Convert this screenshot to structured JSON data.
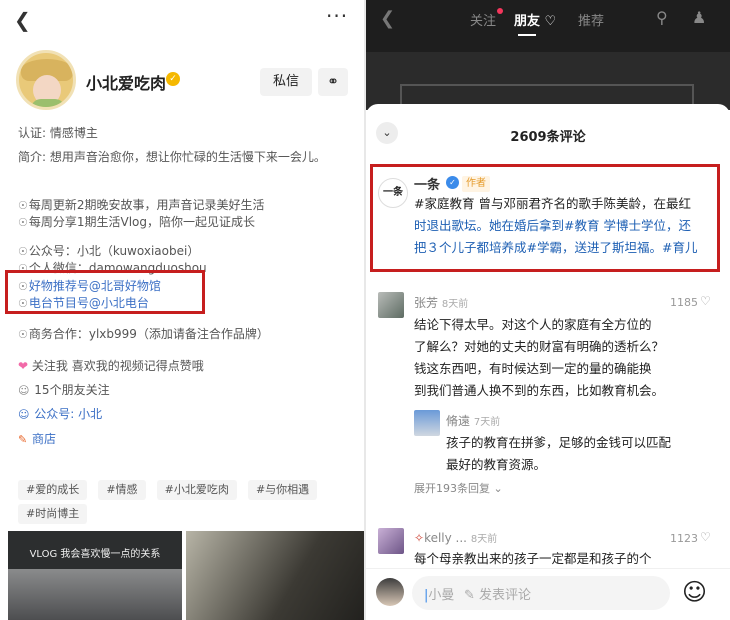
{
  "left": {
    "back_icon": "back-chevron-icon",
    "more_label": "···",
    "username": "小北爱吃肉",
    "message_button": "私信",
    "certification": "认证: 情感博主",
    "intro": "简介: 想用声音治愈你，想让你忙碌的生活慢下来一会儿。",
    "info_lines": [
      "每周更新2期晚安故事，用声音记录美好生活",
      "每周分享1期生活Vlog，陪你一起见证成长",
      "公众号：小北（kuwoxiaobei）",
      "个人微信：damowangduoshou",
      "好物推荐号@北哥好物馆",
      "电台节目号@小北电台",
      "商务合作：ylxb999（添加请备注合作品牌）"
    ],
    "follow_prompt": "关注我 喜欢我的视频记得点赞哦",
    "friends_follow": "15个朋友关注",
    "public_account": "公众号: 小北",
    "shop": "商店",
    "tags": [
      "#爱的成长",
      "#情感",
      "#小北爱吃肉",
      "#与你相遇",
      "#时尚博主"
    ],
    "video_caption": "VLOG 我会喜欢慢一点的关系"
  },
  "right": {
    "tabs": [
      "关注",
      "朋友",
      "推荐"
    ],
    "comment_count": "2609条评论",
    "pinned": {
      "author": "一条",
      "avatar_text": "一条",
      "author_badge": "作者",
      "line1": "#家庭教育 曾与邓丽君齐名的歌手陈美龄，在最红",
      "line2": "时退出歌坛。她在婚后拿到#教育 学博士学位，还",
      "line3": "把３个儿子都培养成#学霸，送进了斯坦福。#育儿"
    },
    "comment1": {
      "author": "张芳",
      "time": "8天前",
      "likes": "1185",
      "lines": [
        "结论下得太早。对这个人的家庭有全方位的",
        "了解么？对她的丈夫的财富有明确的透析么？",
        "钱这东西吧，有时候达到一定的量的确能换",
        "到我们普通人换不到的东西，比如教育机会。"
      ]
    },
    "reply1": {
      "author": "脩遠",
      "time": "7天前",
      "lines": [
        "孩子的教育在拼爹，足够的金钱可以匹配",
        "最好的教育资源。"
      ]
    },
    "expand_replies": "展开193条回复",
    "comment2": {
      "author": "kelly ...",
      "time": "8天前",
      "likes": "1123",
      "line": "每个母亲教出来的孩子一定都是和孩子的个"
    },
    "input": {
      "mention": "小曼",
      "placeholder": "发表评论"
    },
    "colors": {
      "accent_red": "#c61e1e",
      "hashtag_blue": "#1d5fb3"
    }
  }
}
